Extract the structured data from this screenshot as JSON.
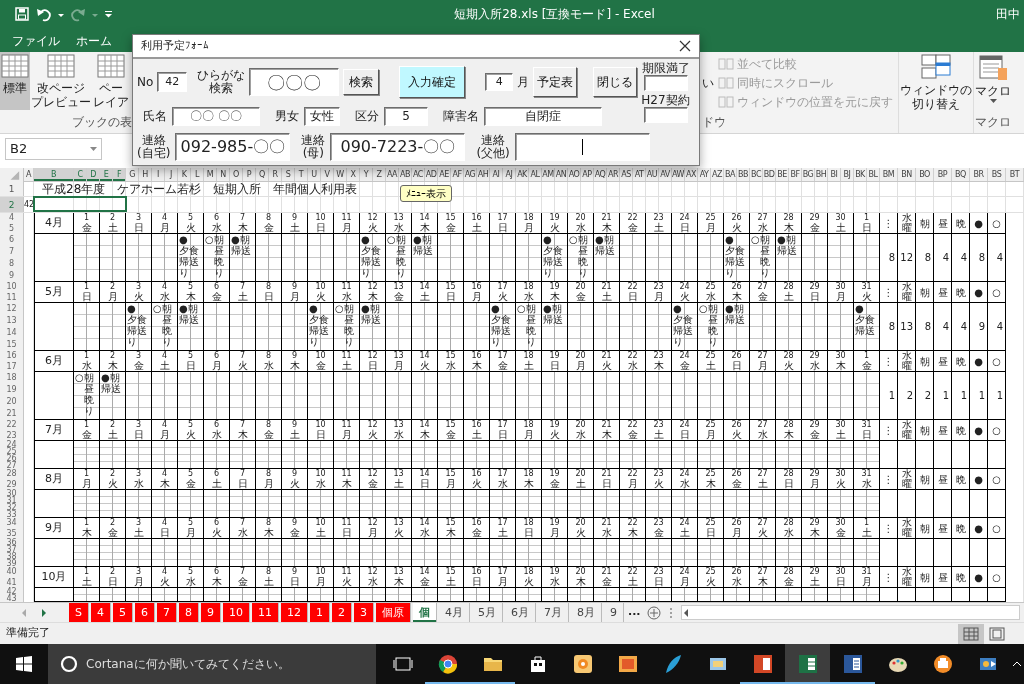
{
  "titlebar": {
    "title": "短期入所28.xls  [互換モード] - Excel",
    "user": "田中",
    "quick_access": [
      {
        "kind": "save",
        "disabled": false
      },
      {
        "kind": "undo",
        "disabled": false
      },
      {
        "kind": "redo",
        "disabled": true
      },
      {
        "kind": "customize",
        "disabled": false
      }
    ]
  },
  "ribbon_tabs": [
    {
      "label": "ファイル",
      "selected": false
    },
    {
      "label": "ホーム",
      "selected": false
    }
  ],
  "ribbon": {
    "view_buttons": [
      {
        "label": [
          "標準"
        ],
        "selected": true
      },
      {
        "label": [
          "改ページ",
          "プレビュー"
        ],
        "selected": false
      },
      {
        "label": [
          "ペー",
          "レイア"
        ],
        "selected": false
      }
    ],
    "view_group_label": "ブックの表",
    "window_cut_label": "い",
    "window_items": [
      {
        "label": "並べて比較",
        "disabled": true
      },
      {
        "label": "同時にスクロール",
        "disabled": true
      },
      {
        "label": "ウィンドウの位置を元に戻す",
        "disabled": true
      }
    ],
    "window_group_label": "ドウ",
    "switch_button": [
      "ウィンドウの",
      "切り替え"
    ],
    "macro_button": "マクロ",
    "macro_group_label": "マクロ"
  },
  "name_box": "B2",
  "dialog": {
    "title": "利用予定ﾌｫｰﾑ",
    "no": {
      "label": "No",
      "value": "42"
    },
    "search": {
      "label": [
        "ひらがな",
        "検索"
      ],
      "value": "〇〇〇",
      "button": "検索"
    },
    "confirm_button": "入力確定",
    "month": {
      "value": "4",
      "unit": "月",
      "button": "予定表"
    },
    "close_button": "閉じる",
    "expiry": {
      "label": "期限満了"
    },
    "contract": {
      "label": "H27契約"
    },
    "fields": [
      {
        "label": "氏名",
        "value": "〇〇 〇〇"
      },
      {
        "label": "男女",
        "value": "女性"
      },
      {
        "label": "区分",
        "value": "5"
      },
      {
        "label": "障害名",
        "value": "自閉症"
      }
    ],
    "contacts": [
      {
        "label": [
          "連絡",
          "(自宅)"
        ],
        "value": "092-985-〇〇",
        "focused": false
      },
      {
        "label": [
          "連絡",
          "(母)"
        ],
        "value": "090-7223-〇〇",
        "focused": false
      },
      {
        "label": [
          "連絡",
          "(父他)"
        ],
        "focused": true
      }
    ]
  },
  "sheet": {
    "columns": [
      {
        "label": "A",
        "selected": false
      },
      {
        "label": "B",
        "selected": true
      },
      {
        "label": "C",
        "selected": true
      },
      {
        "label": "D",
        "selected": true
      },
      {
        "label": "E",
        "selected": true
      },
      {
        "label": "F",
        "selected": true
      },
      {
        "label": "G",
        "selected": false
      },
      {
        "label": "H",
        "selected": false
      },
      {
        "label": "I",
        "selected": false
      },
      {
        "label": "J",
        "selected": false
      },
      {
        "label": "K",
        "selected": false
      },
      {
        "label": "L",
        "selected": false
      },
      {
        "label": "M",
        "selected": false
      },
      {
        "label": "N",
        "selected": false
      },
      {
        "label": "O",
        "selected": false
      },
      {
        "label": "P",
        "selected": false
      },
      {
        "label": "Q",
        "selected": false
      },
      {
        "label": "R",
        "selected": false
      },
      {
        "label": "S",
        "selected": false
      },
      {
        "label": "T",
        "selected": false
      },
      {
        "label": "U",
        "selected": false
      },
      {
        "label": "V",
        "selected": false
      },
      {
        "label": "W",
        "selected": false
      },
      {
        "label": "X",
        "selected": false
      },
      {
        "label": "Y",
        "selected": false
      },
      {
        "label": "Z",
        "selected": false
      },
      {
        "label": "AA",
        "selected": false
      },
      {
        "label": "AB",
        "selected": false
      },
      {
        "label": "AC",
        "selected": false
      },
      {
        "label": "AD",
        "selected": false
      },
      {
        "label": "AE",
        "selected": false
      },
      {
        "label": "AF",
        "selected": false
      },
      {
        "label": "AG",
        "selected": false
      },
      {
        "label": "AH",
        "selected": false
      },
      {
        "label": "AI",
        "selected": false
      },
      {
        "label": "AJ",
        "selected": false
      },
      {
        "label": "AK",
        "selected": false
      },
      {
        "label": "AL",
        "selected": false
      },
      {
        "label": "AM",
        "selected": false
      },
      {
        "label": "AN",
        "selected": false
      },
      {
        "label": "AO",
        "selected": false
      },
      {
        "label": "AP",
        "selected": false
      },
      {
        "label": "AQ",
        "selected": false
      },
      {
        "label": "AR",
        "selected": false
      },
      {
        "label": "AS",
        "selected": false
      },
      {
        "label": "AT",
        "selected": false
      },
      {
        "label": "AU",
        "selected": false
      },
      {
        "label": "AV",
        "selected": false
      },
      {
        "label": "AW",
        "selected": false
      },
      {
        "label": "AX",
        "selected": false
      },
      {
        "label": "AY",
        "selected": false
      },
      {
        "label": "AZ",
        "selected": false
      },
      {
        "label": "BA",
        "selected": false
      },
      {
        "label": "BB",
        "selected": false
      },
      {
        "label": "BC",
        "selected": false
      },
      {
        "label": "BD",
        "selected": false
      },
      {
        "label": "BE",
        "selected": false
      },
      {
        "label": "BF",
        "selected": false
      },
      {
        "label": "BG",
        "selected": false
      },
      {
        "label": "BH",
        "selected": false
      },
      {
        "label": "BI",
        "selected": false
      },
      {
        "label": "BJ",
        "selected": false
      },
      {
        "label": "BK",
        "selected": false
      },
      {
        "label": "BL",
        "selected": false
      },
      {
        "label": "BM",
        "selected": false
      },
      {
        "label": "BN",
        "selected": false
      },
      {
        "label": "BO",
        "selected": false
      },
      {
        "label": "BP",
        "selected": false
      },
      {
        "label": "BQ",
        "selected": false
      },
      {
        "label": "BR",
        "selected": false
      },
      {
        "label": "BS",
        "selected": false
      },
      {
        "label": "BT",
        "selected": false
      }
    ],
    "rows": [
      {
        "label": "1",
        "selected": false
      },
      {
        "label": "2",
        "selected": true
      }
    ],
    "title": "平成28年度　ケアホーム若杉　短期入所　年間個人利用表",
    "a2": "42",
    "menu_button": "ﾒﾆｭｰ表示",
    "months": [
      {
        "label": "4月",
        "rows": [
          "4",
          "5",
          "6",
          "7",
          "8",
          "9"
        ],
        "days": [
          {
            "n": "1",
            "w": "金"
          },
          {
            "n": "2",
            "w": "土"
          },
          {
            "n": "3",
            "w": "日"
          },
          {
            "n": "4",
            "w": "月"
          },
          {
            "n": "5",
            "w": "火",
            "mark": {
              "symbol": "●",
              "below": [
                "夕食",
                "帰送",
                "り"
              ]
            }
          },
          {
            "n": "6",
            "w": "水",
            "mark": {
              "symbol": "○",
              "side": "朝昼晩り"
            }
          },
          {
            "n": "7",
            "w": "木",
            "mark": {
              "symbol": "●",
              "side": "朝",
              "below": [
                "帰送"
              ]
            }
          },
          {
            "n": "8",
            "w": "金"
          },
          {
            "n": "9",
            "w": "土"
          },
          {
            "n": "10",
            "w": "日"
          },
          {
            "n": "11",
            "w": "月"
          },
          {
            "n": "12",
            "w": "火",
            "mark": {
              "symbol": "●",
              "below": [
                "夕食",
                "帰送",
                "り"
              ]
            }
          },
          {
            "n": "13",
            "w": "水",
            "mark": {
              "symbol": "○",
              "side": "朝昼晩り"
            }
          },
          {
            "n": "14",
            "w": "木",
            "mark": {
              "symbol": "●",
              "side": "朝",
              "below": [
                "帰送"
              ]
            }
          },
          {
            "n": "15",
            "w": "金"
          },
          {
            "n": "16",
            "w": "土"
          },
          {
            "n": "17",
            "w": "日"
          },
          {
            "n": "18",
            "w": "月"
          },
          {
            "n": "19",
            "w": "火",
            "mark": {
              "symbol": "●",
              "below": [
                "夕食",
                "帰送",
                "り"
              ]
            }
          },
          {
            "n": "20",
            "w": "水",
            "mark": {
              "symbol": "○",
              "side": "朝昼晩り"
            }
          },
          {
            "n": "21",
            "w": "木",
            "mark": {
              "symbol": "●",
              "side": "朝",
              "below": [
                "帰送"
              ]
            }
          },
          {
            "n": "22",
            "w": "金"
          },
          {
            "n": "23",
            "w": "土"
          },
          {
            "n": "24",
            "w": "日"
          },
          {
            "n": "25",
            "w": "月"
          },
          {
            "n": "26",
            "w": "火",
            "mark": {
              "symbol": "●",
              "below": [
                "夕食",
                "帰送",
                "り"
              ]
            }
          },
          {
            "n": "27",
            "w": "水",
            "mark": {
              "symbol": "○",
              "side": "朝昼晩り"
            }
          },
          {
            "n": "28",
            "w": "木",
            "mark": {
              "symbol": "●",
              "side": "朝",
              "below": [
                "帰送"
              ]
            }
          },
          {
            "n": "29",
            "w": "金"
          },
          {
            "n": "30",
            "w": "土"
          },
          {
            "n": "1",
            "w": "日"
          }
        ],
        "summary": {
          "headers": [
            "⋮",
            "水曜",
            "朝",
            "昼",
            "晩",
            "●",
            "○"
          ],
          "counts": [
            "8",
            "12",
            "8",
            "4",
            "4",
            "8",
            "4"
          ]
        }
      },
      {
        "label": "5月",
        "rows": [
          "10",
          "11",
          "12",
          "13",
          "14",
          "15"
        ],
        "days": [
          {
            "n": "1",
            "w": "日"
          },
          {
            "n": "2",
            "w": "月"
          },
          {
            "n": "3",
            "w": "火",
            "mark": {
              "symbol": "●",
              "below": [
                "夕食",
                "帰送",
                "り"
              ]
            }
          },
          {
            "n": "4",
            "w": "水",
            "mark": {
              "symbol": "○",
              "side": "朝昼晩り"
            }
          },
          {
            "n": "5",
            "w": "木",
            "mark": {
              "symbol": "●",
              "side": "朝",
              "below": [
                "帰送"
              ]
            }
          },
          {
            "n": "6",
            "w": "金"
          },
          {
            "n": "7",
            "w": "土"
          },
          {
            "n": "8",
            "w": "日"
          },
          {
            "n": "9",
            "w": "月"
          },
          {
            "n": "10",
            "w": "火",
            "mark": {
              "symbol": "●",
              "below": [
                "夕食",
                "帰送",
                "り"
              ]
            }
          },
          {
            "n": "11",
            "w": "水",
            "mark": {
              "symbol": "○",
              "side": "朝昼晩り"
            }
          },
          {
            "n": "12",
            "w": "木",
            "mark": {
              "symbol": "●",
              "side": "朝",
              "below": [
                "帰送"
              ]
            }
          },
          {
            "n": "13",
            "w": "金"
          },
          {
            "n": "14",
            "w": "土"
          },
          {
            "n": "15",
            "w": "日"
          },
          {
            "n": "16",
            "w": "月"
          },
          {
            "n": "17",
            "w": "火",
            "mark": {
              "symbol": "●",
              "below": [
                "夕食",
                "帰送",
                "り"
              ]
            }
          },
          {
            "n": "18",
            "w": "水",
            "mark": {
              "symbol": "○",
              "side": "朝昼晩り"
            }
          },
          {
            "n": "19",
            "w": "木",
            "mark": {
              "symbol": "●",
              "side": "朝",
              "below": [
                "帰送"
              ]
            }
          },
          {
            "n": "20",
            "w": "金"
          },
          {
            "n": "21",
            "w": "土"
          },
          {
            "n": "22",
            "w": "日"
          },
          {
            "n": "23",
            "w": "月"
          },
          {
            "n": "24",
            "w": "火",
            "mark": {
              "symbol": "●",
              "below": [
                "夕食",
                "帰送",
                "り"
              ]
            }
          },
          {
            "n": "25",
            "w": "水",
            "mark": {
              "symbol": "○",
              "side": "朝昼晩り"
            }
          },
          {
            "n": "26",
            "w": "木",
            "mark": {
              "symbol": "●",
              "side": "朝",
              "below": [
                "帰送"
              ]
            }
          },
          {
            "n": "27",
            "w": "金"
          },
          {
            "n": "28",
            "w": "土"
          },
          {
            "n": "29",
            "w": "日"
          },
          {
            "n": "30",
            "w": "月"
          },
          {
            "n": "31",
            "w": "火",
            "mark": {
              "symbol": "●",
              "below": [
                "夕食",
                "帰送"
              ]
            }
          }
        ],
        "summary": {
          "headers": [
            "⋮",
            "水曜",
            "朝",
            "昼",
            "晩",
            "●",
            "○"
          ],
          "counts": [
            "8",
            "13",
            "8",
            "4",
            "4",
            "9",
            "4"
          ]
        }
      },
      {
        "label": "6月",
        "rows": [
          "16",
          "17",
          "18",
          "19",
          "20",
          "21"
        ],
        "days": [
          {
            "n": "1",
            "w": "水",
            "mark": {
              "symbol": "○",
              "side": "朝昼晩り"
            }
          },
          {
            "n": "2",
            "w": "木",
            "mark": {
              "symbol": "●",
              "side": "朝",
              "below": [
                "帰送"
              ]
            }
          },
          {
            "n": "3",
            "w": "金"
          },
          {
            "n": "4",
            "w": "土"
          },
          {
            "n": "5",
            "w": "日"
          },
          {
            "n": "6",
            "w": "月"
          },
          {
            "n": "7",
            "w": "火"
          },
          {
            "n": "8",
            "w": "水"
          },
          {
            "n": "9",
            "w": "木"
          },
          {
            "n": "10",
            "w": "金"
          },
          {
            "n": "11",
            "w": "土"
          },
          {
            "n": "12",
            "w": "日"
          },
          {
            "n": "13",
            "w": "月"
          },
          {
            "n": "14",
            "w": "火"
          },
          {
            "n": "15",
            "w": "水"
          },
          {
            "n": "16",
            "w": "木"
          },
          {
            "n": "17",
            "w": "金"
          },
          {
            "n": "18",
            "w": "土"
          },
          {
            "n": "19",
            "w": "日"
          },
          {
            "n": "20",
            "w": "月"
          },
          {
            "n": "21",
            "w": "火"
          },
          {
            "n": "22",
            "w": "水"
          },
          {
            "n": "23",
            "w": "木"
          },
          {
            "n": "24",
            "w": "金"
          },
          {
            "n": "25",
            "w": "土"
          },
          {
            "n": "26",
            "w": "日"
          },
          {
            "n": "27",
            "w": "月"
          },
          {
            "n": "28",
            "w": "火"
          },
          {
            "n": "29",
            "w": "水"
          },
          {
            "n": "30",
            "w": "木"
          },
          {
            "n": "1",
            "w": "金"
          }
        ],
        "summary": {
          "headers": [
            "⋮",
            "水曜",
            "朝",
            "昼",
            "晩",
            "●",
            "○"
          ],
          "counts": [
            "1",
            "2",
            "2",
            "1",
            "1",
            "1",
            "1"
          ]
        }
      },
      {
        "label": "7月",
        "rows": [
          "22",
          "23",
          "24",
          "25",
          "26",
          "27"
        ],
        "days": [
          {
            "n": "1",
            "w": "金"
          },
          {
            "n": "2",
            "w": "土"
          },
          {
            "n": "3",
            "w": "日"
          },
          {
            "n": "4",
            "w": "月"
          },
          {
            "n": "5",
            "w": "火"
          },
          {
            "n": "6",
            "w": "水"
          },
          {
            "n": "7",
            "w": "木"
          },
          {
            "n": "8",
            "w": "金"
          },
          {
            "n": "9",
            "w": "土"
          },
          {
            "n": "10",
            "w": "日"
          },
          {
            "n": "11",
            "w": "月"
          },
          {
            "n": "12",
            "w": "火"
          },
          {
            "n": "13",
            "w": "水"
          },
          {
            "n": "14",
            "w": "木"
          },
          {
            "n": "15",
            "w": "金"
          },
          {
            "n": "16",
            "w": "土"
          },
          {
            "n": "17",
            "w": "日"
          },
          {
            "n": "18",
            "w": "月"
          },
          {
            "n": "19",
            "w": "火"
          },
          {
            "n": "20",
            "w": "水"
          },
          {
            "n": "21",
            "w": "木"
          },
          {
            "n": "22",
            "w": "金"
          },
          {
            "n": "23",
            "w": "土"
          },
          {
            "n": "24",
            "w": "日"
          },
          {
            "n": "25",
            "w": "月"
          },
          {
            "n": "26",
            "w": "火"
          },
          {
            "n": "27",
            "w": "水"
          },
          {
            "n": "28",
            "w": "木"
          },
          {
            "n": "29",
            "w": "金"
          },
          {
            "n": "30",
            "w": "土"
          },
          {
            "n": "31",
            "w": "日"
          }
        ],
        "summary": {
          "headers": [
            "⋮",
            "水曜",
            "朝",
            "昼",
            "晩",
            "●",
            "○"
          ]
        }
      },
      {
        "label": "8月",
        "rows": [
          "28",
          "29",
          "30",
          "31",
          "32",
          "33"
        ],
        "days": [
          {
            "n": "1",
            "w": "月"
          },
          {
            "n": "2",
            "w": "火"
          },
          {
            "n": "3",
            "w": "水"
          },
          {
            "n": "4",
            "w": "木"
          },
          {
            "n": "5",
            "w": "金"
          },
          {
            "n": "6",
            "w": "土"
          },
          {
            "n": "7",
            "w": "日"
          },
          {
            "n": "8",
            "w": "月"
          },
          {
            "n": "9",
            "w": "火"
          },
          {
            "n": "10",
            "w": "水"
          },
          {
            "n": "11",
            "w": "木"
          },
          {
            "n": "12",
            "w": "金"
          },
          {
            "n": "13",
            "w": "土"
          },
          {
            "n": "14",
            "w": "日"
          },
          {
            "n": "15",
            "w": "月"
          },
          {
            "n": "16",
            "w": "火"
          },
          {
            "n": "17",
            "w": "水"
          },
          {
            "n": "18",
            "w": "木"
          },
          {
            "n": "19",
            "w": "金"
          },
          {
            "n": "20",
            "w": "土"
          },
          {
            "n": "21",
            "w": "日"
          },
          {
            "n": "22",
            "w": "月"
          },
          {
            "n": "23",
            "w": "火"
          },
          {
            "n": "24",
            "w": "水"
          },
          {
            "n": "25",
            "w": "木"
          },
          {
            "n": "26",
            "w": "金"
          },
          {
            "n": "27",
            "w": "土"
          },
          {
            "n": "28",
            "w": "日"
          },
          {
            "n": "29",
            "w": "月"
          },
          {
            "n": "30",
            "w": "火"
          },
          {
            "n": "31",
            "w": "水"
          }
        ],
        "summary": {
          "headers": [
            "⋮",
            "水曜",
            "朝",
            "昼",
            "晩",
            "●",
            "○"
          ]
        }
      },
      {
        "label": "9月",
        "rows": [
          "34",
          "35",
          "36",
          "37",
          "38",
          "39"
        ],
        "days": [
          {
            "n": "1",
            "w": "木"
          },
          {
            "n": "2",
            "w": "金"
          },
          {
            "n": "3",
            "w": "土"
          },
          {
            "n": "4",
            "w": "日"
          },
          {
            "n": "5",
            "w": "月"
          },
          {
            "n": "6",
            "w": "火"
          },
          {
            "n": "7",
            "w": "水"
          },
          {
            "n": "8",
            "w": "木"
          },
          {
            "n": "9",
            "w": "金"
          },
          {
            "n": "10",
            "w": "土"
          },
          {
            "n": "11",
            "w": "日"
          },
          {
            "n": "12",
            "w": "月"
          },
          {
            "n": "13",
            "w": "火"
          },
          {
            "n": "14",
            "w": "水"
          },
          {
            "n": "15",
            "w": "木"
          },
          {
            "n": "16",
            "w": "金"
          },
          {
            "n": "17",
            "w": "土"
          },
          {
            "n": "18",
            "w": "日"
          },
          {
            "n": "19",
            "w": "月"
          },
          {
            "n": "20",
            "w": "火"
          },
          {
            "n": "21",
            "w": "水"
          },
          {
            "n": "22",
            "w": "木"
          },
          {
            "n": "23",
            "w": "金"
          },
          {
            "n": "24",
            "w": "土"
          },
          {
            "n": "25",
            "w": "日"
          },
          {
            "n": "26",
            "w": "月"
          },
          {
            "n": "27",
            "w": "火"
          },
          {
            "n": "28",
            "w": "水"
          },
          {
            "n": "29",
            "w": "木"
          },
          {
            "n": "30",
            "w": "金"
          },
          {
            "n": "1",
            "w": "土"
          }
        ],
        "summary": {
          "headers": [
            "⋮",
            "水曜",
            "朝",
            "昼",
            "晩",
            "●",
            "○"
          ]
        }
      },
      {
        "label": "10月",
        "rows": [
          "40",
          "41",
          "42",
          "43"
        ],
        "days": [
          {
            "n": "1",
            "w": "土"
          },
          {
            "n": "2",
            "w": "日"
          },
          {
            "n": "3",
            "w": "月"
          },
          {
            "n": "4",
            "w": "火"
          },
          {
            "n": "5",
            "w": "水"
          },
          {
            "n": "6",
            "w": "木"
          },
          {
            "n": "7",
            "w": "金"
          },
          {
            "n": "8",
            "w": "土"
          },
          {
            "n": "9",
            "w": "日"
          },
          {
            "n": "10",
            "w": "月"
          },
          {
            "n": "11",
            "w": "火"
          },
          {
            "n": "12",
            "w": "水"
          },
          {
            "n": "13",
            "w": "木"
          },
          {
            "n": "14",
            "w": "金"
          },
          {
            "n": "15",
            "w": "土"
          },
          {
            "n": "16",
            "w": "日"
          },
          {
            "n": "17",
            "w": "月"
          },
          {
            "n": "18",
            "w": "火"
          },
          {
            "n": "19",
            "w": "水"
          },
          {
            "n": "20",
            "w": "木"
          },
          {
            "n": "21",
            "w": "金"
          },
          {
            "n": "22",
            "w": "土"
          },
          {
            "n": "23",
            "w": "日"
          },
          {
            "n": "24",
            "w": "月"
          },
          {
            "n": "25",
            "w": "火"
          },
          {
            "n": "26",
            "w": "水"
          },
          {
            "n": "27",
            "w": "木"
          },
          {
            "n": "28",
            "w": "金"
          },
          {
            "n": "29",
            "w": "土"
          },
          {
            "n": "30",
            "w": "日"
          },
          {
            "n": "31",
            "w": "月"
          }
        ],
        "summary": {
          "headers": [
            "⋮",
            "水曜",
            "朝",
            "昼",
            "晩",
            "●",
            "○"
          ]
        }
      }
    ]
  },
  "sheet_tabs": [
    {
      "label": "S",
      "color": "#ff0000",
      "selected": false
    },
    {
      "label": "4",
      "color": "#ff0000",
      "selected": false
    },
    {
      "label": "5",
      "color": "#ff0000",
      "selected": false
    },
    {
      "label": "6",
      "color": "#ff0000",
      "selected": false
    },
    {
      "label": "7",
      "color": "#ff0000",
      "selected": false
    },
    {
      "label": "8",
      "color": "#ff0000",
      "selected": false
    },
    {
      "label": "9",
      "color": "#ff0000",
      "selected": false
    },
    {
      "label": "10",
      "color": "#ff0000",
      "selected": false
    },
    {
      "label": "11",
      "color": "#ff0000",
      "selected": false
    },
    {
      "label": "12",
      "color": "#ff0000",
      "selected": false
    },
    {
      "label": "1",
      "color": "#ff0000",
      "selected": false
    },
    {
      "label": "2",
      "color": "#ff0000",
      "selected": false
    },
    {
      "label": "3",
      "color": "#ff0000",
      "selected": false
    },
    {
      "label": "個原",
      "color": "#ff0000",
      "selected": false
    },
    {
      "label": "個",
      "selected": true
    },
    {
      "label": "4月",
      "selected": false
    },
    {
      "label": "5月",
      "selected": false
    },
    {
      "label": "6月",
      "selected": false
    },
    {
      "label": "7月",
      "selected": false
    },
    {
      "label": "8月",
      "selected": false
    },
    {
      "label": "9",
      "selected": false
    }
  ],
  "more_tabs": "...",
  "status_bar": {
    "text": "準備完了",
    "views": [
      {
        "kind": "normal",
        "selected": true
      },
      {
        "kind": "page",
        "selected": false
      }
    ]
  },
  "taskbar": {
    "search": "Cortanaに何か聞いてみてください。",
    "apps": [
      {
        "kind": "taskview",
        "running": false,
        "active": false
      },
      {
        "kind": "browser",
        "running": true,
        "active": false
      },
      {
        "kind": "folder",
        "running": true,
        "active": false
      },
      {
        "kind": "store",
        "running": false,
        "active": false
      },
      {
        "kind": "flower",
        "running": false,
        "active": false
      },
      {
        "kind": "picture",
        "running": false,
        "active": false
      },
      {
        "kind": "feather",
        "running": false,
        "active": false
      },
      {
        "kind": "card",
        "running": false,
        "active": false
      },
      {
        "kind": "presentation",
        "running": true,
        "active": false
      },
      {
        "kind": "spreadsheet",
        "running": true,
        "active": true
      },
      {
        "kind": "document",
        "running": true,
        "active": false
      },
      {
        "kind": "palette",
        "running": false,
        "active": false
      },
      {
        "kind": "printer",
        "running": false,
        "active": false
      },
      {
        "kind": "film",
        "running": false,
        "active": false
      }
    ]
  }
}
